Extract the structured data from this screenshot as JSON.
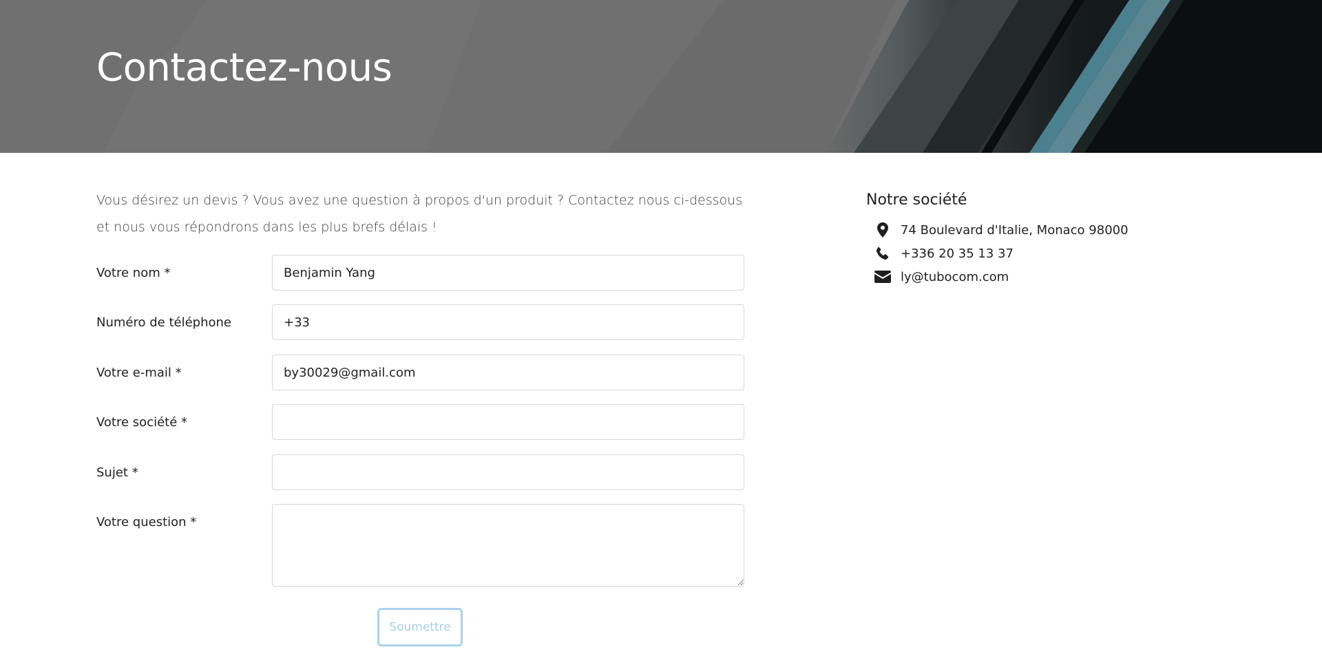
{
  "hero": {
    "title": "Contactez-nous"
  },
  "intro": {
    "text": "Vous désirez un devis ? Vous avez une question à propos d'un produit ? Contactez nous ci-dessous et nous vous répondrons dans les plus brefs délais !"
  },
  "form": {
    "name": {
      "label": "Votre nom *",
      "value": "Benjamin Yang"
    },
    "phone": {
      "label": "Numéro de téléphone",
      "value": "+33"
    },
    "email": {
      "label": "Votre e-mail *",
      "value": "by30029@gmail.com"
    },
    "company": {
      "label": "Votre société *",
      "value": ""
    },
    "subject": {
      "label": "Sujet *",
      "value": ""
    },
    "question": {
      "label": "Votre question *",
      "value": ""
    },
    "submit_label": "Soumettre"
  },
  "company": {
    "title": "Notre société",
    "address": "74 Boulevard d'Italie, Monaco 98000",
    "phone": "+336 20 35 13 37",
    "email": "ly@tubocom.com",
    "icons": [
      "map-marker-icon",
      "phone-icon",
      "envelope-icon"
    ]
  },
  "colors": {
    "accent": "#a8d4ec",
    "hero_overlay": "#6e6e6e",
    "text": "#222222"
  }
}
